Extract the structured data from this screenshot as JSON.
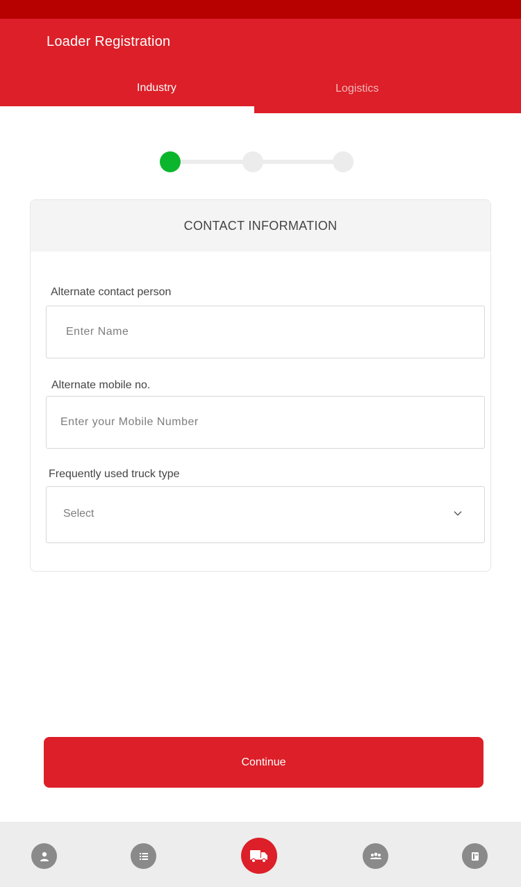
{
  "header": {
    "title": "Loader Registration",
    "tabs": [
      {
        "label": "Industry",
        "active": true
      },
      {
        "label": "Logistics",
        "active": false
      }
    ]
  },
  "stepper": {
    "total_steps": 3,
    "current_step": 1,
    "active_color": "#0bb52c",
    "inactive_color": "#ececec"
  },
  "card": {
    "title": "CONTACT INFORMATION",
    "fields": {
      "alternate_contact": {
        "label": "Alternate contact person",
        "placeholder": "Enter Name",
        "value": ""
      },
      "alternate_mobile": {
        "label": "Alternate mobile no.",
        "placeholder": "Enter your Mobile Number",
        "value": ""
      },
      "truck_type": {
        "label": "Frequently used truck type",
        "selected": "Select"
      }
    }
  },
  "continue_label": "Continue",
  "bottom_nav": {
    "items": [
      {
        "icon": "person-icon",
        "active": false
      },
      {
        "icon": "list-icon",
        "active": false
      },
      {
        "icon": "truck-icon",
        "active": true
      },
      {
        "icon": "group-icon",
        "active": false
      },
      {
        "icon": "notebook-icon",
        "active": false
      }
    ]
  },
  "colors": {
    "primary": "#dc1f28",
    "status_bar": "#b70000",
    "nav_bg": "#ededed",
    "nav_icon": "#8a8a8a"
  }
}
